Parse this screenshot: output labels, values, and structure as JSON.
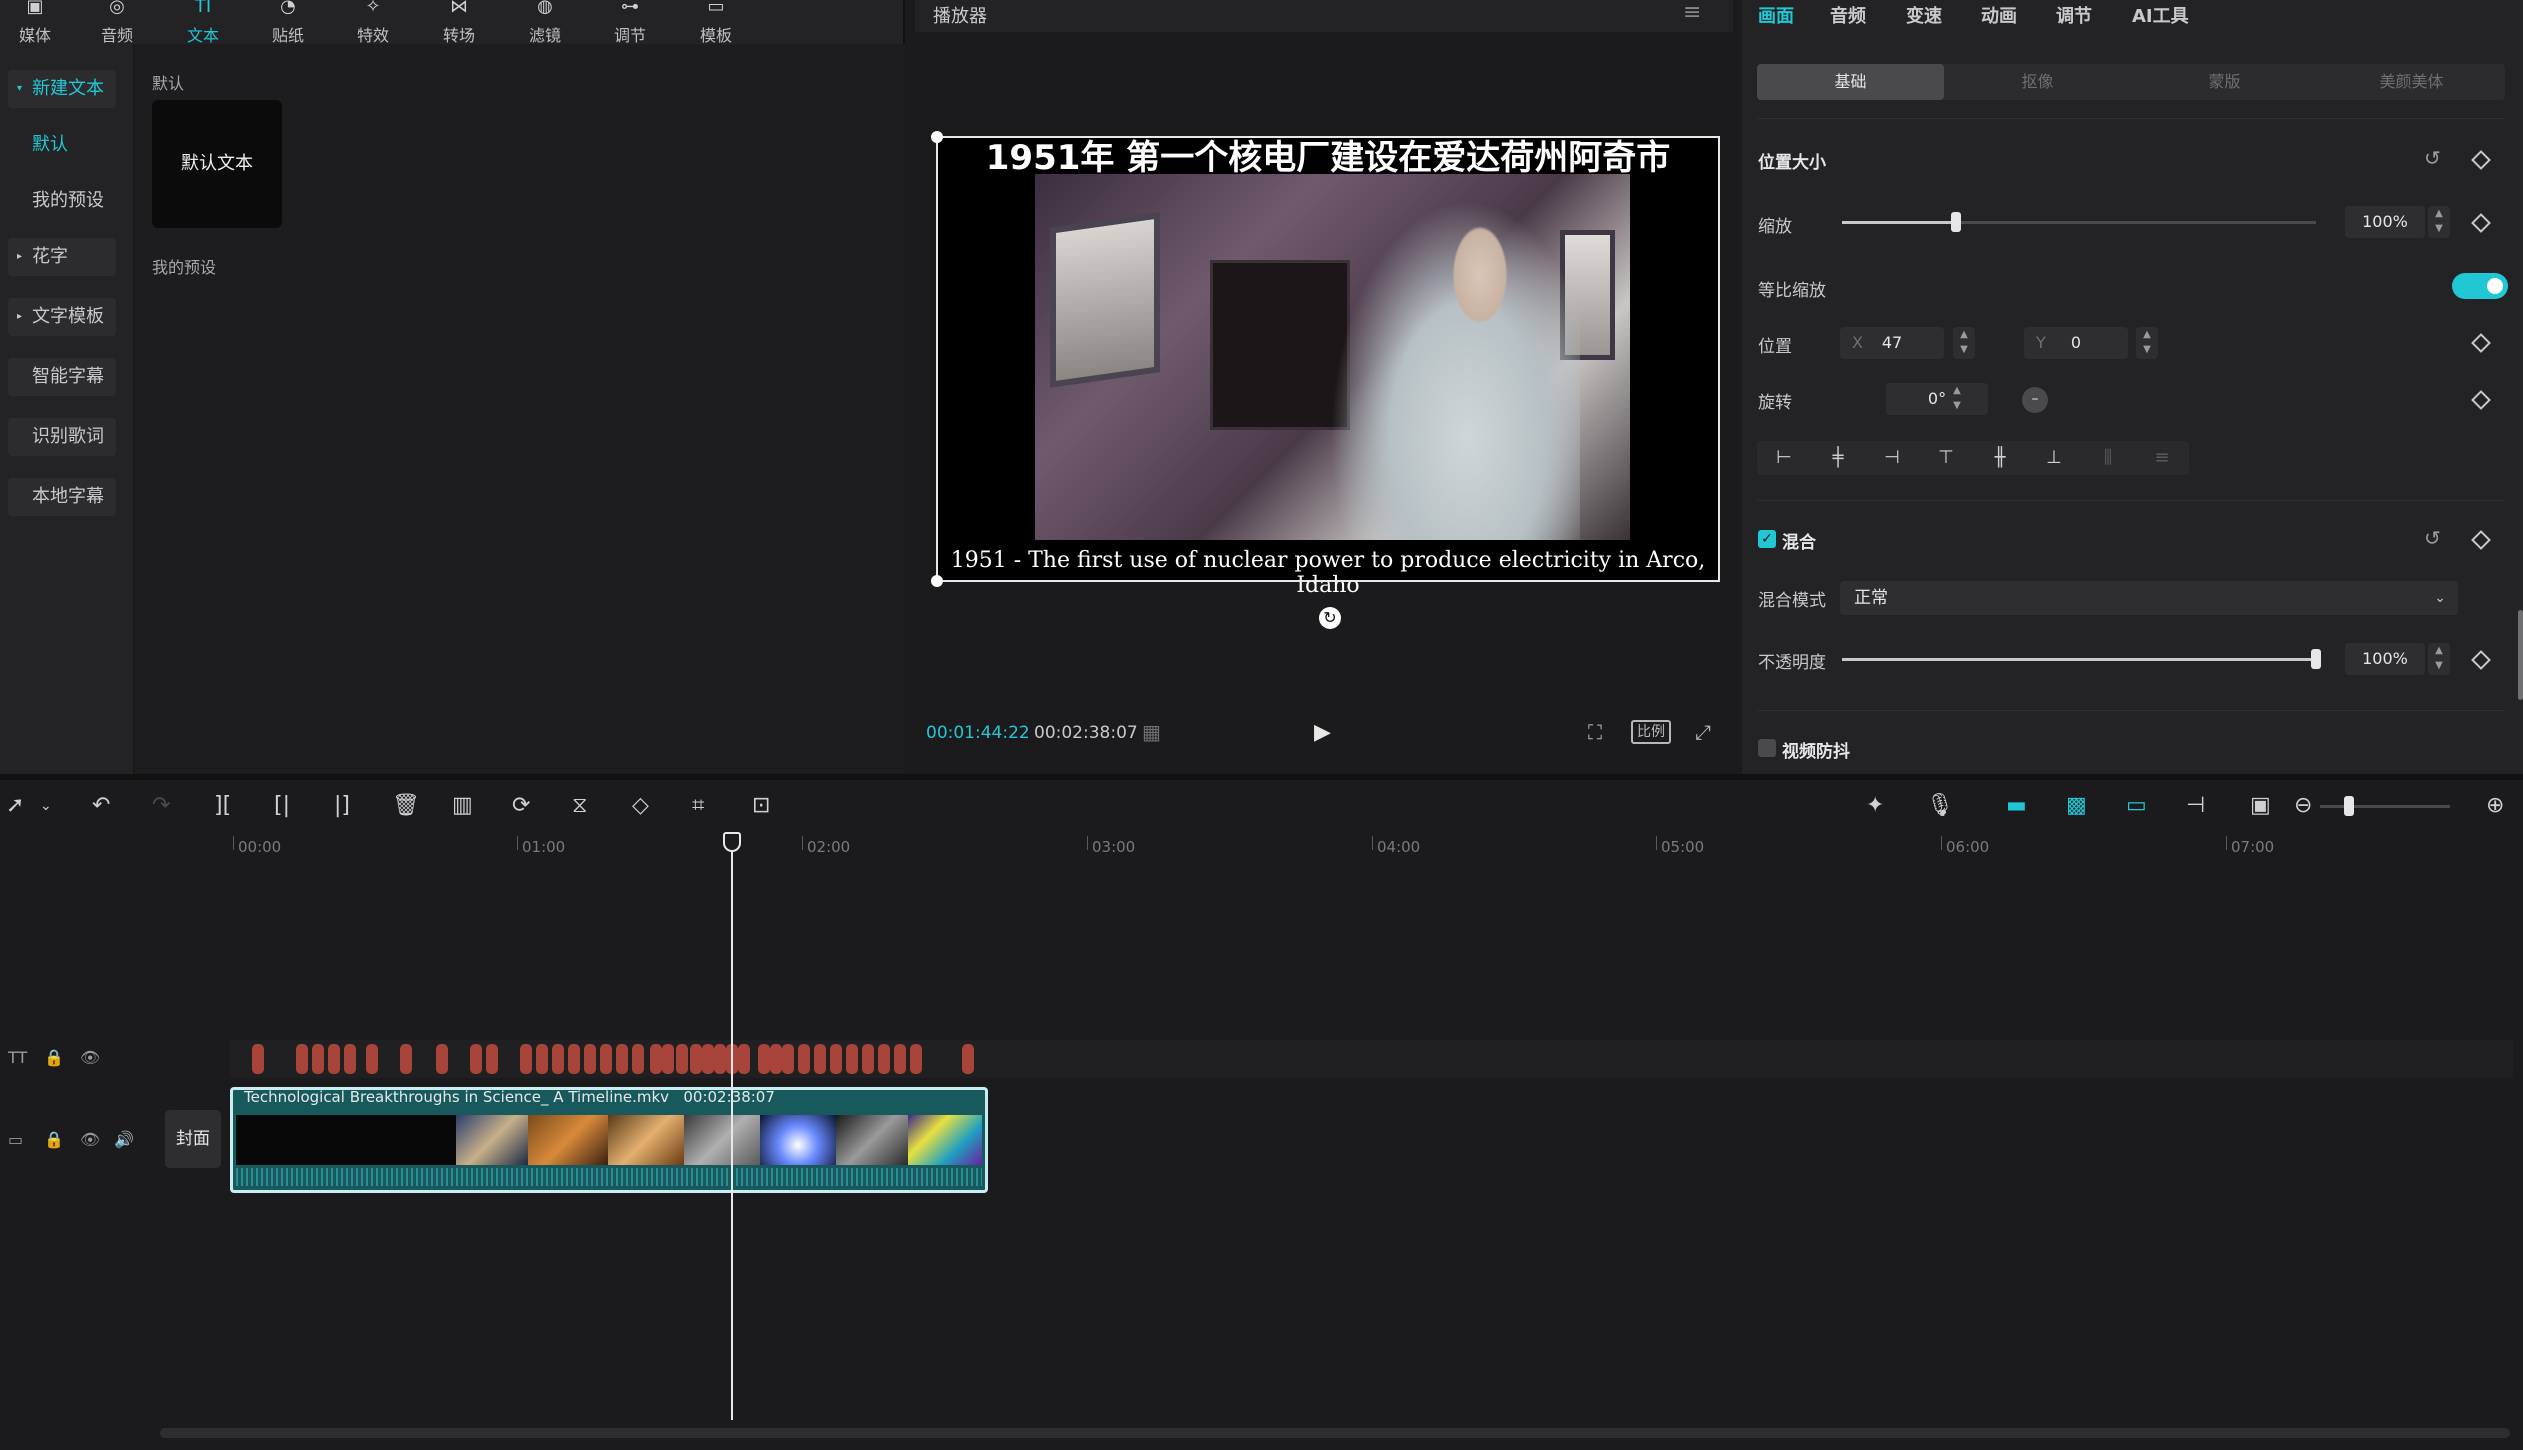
{
  "top_toolbar": {
    "items": [
      {
        "label": "媒体",
        "icon": "media-icon"
      },
      {
        "label": "音频",
        "icon": "audio-icon"
      },
      {
        "label": "文本",
        "icon": "text-icon"
      },
      {
        "label": "贴纸",
        "icon": "sticker-icon"
      },
      {
        "label": "特效",
        "icon": "effects-icon"
      },
      {
        "label": "转场",
        "icon": "transition-icon"
      },
      {
        "label": "滤镜",
        "icon": "filter-icon"
      },
      {
        "label": "调节",
        "icon": "adjust-icon"
      },
      {
        "label": "模板",
        "icon": "template-icon"
      }
    ],
    "active_index": 2
  },
  "left_nav": {
    "new_text": "新建文本",
    "default": "默认",
    "my_presets": "我的预设",
    "fancy_text": "花字",
    "text_template": "文字模板",
    "smart_subtitle": "智能字幕",
    "recognize_lyrics": "识别歌词",
    "local_subtitle": "本地字幕"
  },
  "preset_panel": {
    "default_section": "默认",
    "default_card": "默认文本",
    "my_presets_section": "我的预设"
  },
  "player": {
    "title": "播放器",
    "caption_cn": "1951年 第一个核电厂建设在爱达荷州阿奇市",
    "caption_en": "1951 - The first use of nuclear power to produce electricity in Arco, Idaho",
    "current_time": "00:01:44:22",
    "total_time": "00:02:38:07",
    "ratio_label": "比例"
  },
  "right_panel": {
    "tabs": [
      "画面",
      "音频",
      "变速",
      "动画",
      "调节",
      "AI工具"
    ],
    "active_tab": 0,
    "sub_tabs": [
      "基础",
      "抠像",
      "蒙版",
      "美颜美体"
    ],
    "active_sub_tab": 0,
    "position_size": "位置大小",
    "scale_label": "缩放",
    "scale_value": "100%",
    "scale_fraction": 0.24,
    "uniform_scale": "等比缩放",
    "uniform_scale_on": true,
    "position_label": "位置",
    "x_prefix": "X",
    "x_value": "47",
    "y_prefix": "Y",
    "y_value": "0",
    "rotate_label": "旋转",
    "rotate_value": "0°",
    "blend_head": "混合",
    "blend_mode_label": "混合模式",
    "blend_mode_value": "正常",
    "opacity_label": "不透明度",
    "opacity_value": "100%",
    "opacity_fraction": 1.0,
    "stabilize_label": "视频防抖"
  },
  "timeline": {
    "ruler": [
      "00:00",
      "01:00",
      "02:00",
      "03:00",
      "04:00",
      "05:00",
      "06:00",
      "07:00"
    ],
    "cover_label": "封面",
    "clip_name": "Technological Breakthroughs in Science_ A Timeline.mkv",
    "clip_duration": "00:02:38:07"
  },
  "colors": {
    "accent": "#22c7d6",
    "text_clip": "#a9443a",
    "video_clip": "#17595c"
  }
}
